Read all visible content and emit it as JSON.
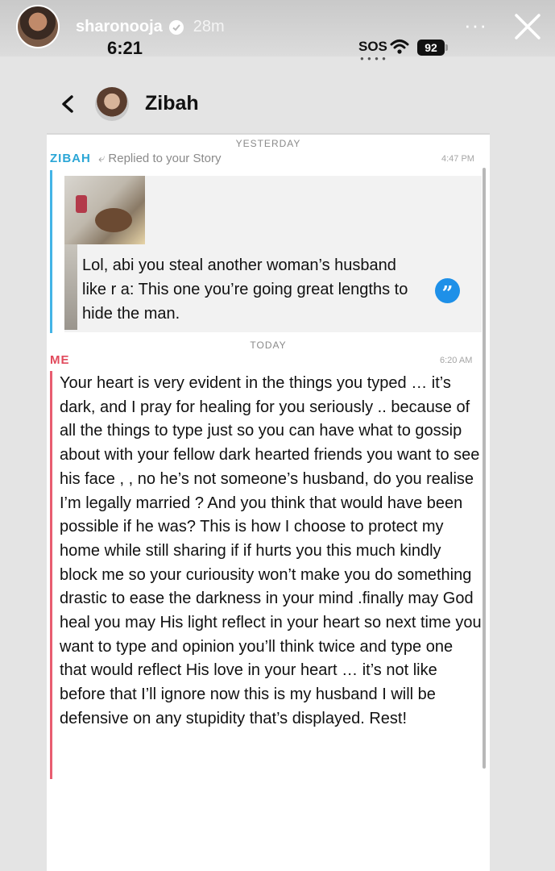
{
  "story": {
    "username": "sharonooja",
    "posted_ago": "28m",
    "more_label": "···",
    "close_icon": "close-icon"
  },
  "status_bar": {
    "time": "6:21",
    "sos": "SOS",
    "battery": "92"
  },
  "chat_header": {
    "back_icon": "chevron-left-icon",
    "contact_name": "Zibah"
  },
  "conversation": {
    "yesterday_label": "YESTERDAY",
    "today_label": "TODAY",
    "incoming": {
      "sender": "ZIBAH",
      "reply_label": "Replied to your Story",
      "time": "4:47 PM",
      "text": "Lol, abi you steal another woman’s husband like r       a: This one you’re going great lengths to hide the man."
    },
    "outgoing": {
      "sender": "ME",
      "time": "6:20 AM",
      "text": "Your heart is very evident in the things you typed … it’s dark, and I pray for healing for you seriously .. because of all the things to type just so you can have what to gossip about with your fellow dark hearted friends you want to see his face , , no he’s not someone’s husband, do you realise I’m legally married ? And you think that would have been possible if he was? This is how I choose to protect my home while still sharing if if hurts you this much kindly block me so your curiousity won’t make you do something drastic to ease the darkness in your mind .finally may God heal you may His light reflect in your heart so next time you want to type and opinion you’ll think twice and type one that would reflect His love in your heart … it’s not like before that I’ll ignore now this is my husband I will be defensive on any stupidity that’s displayed. Rest!"
    }
  },
  "colors": {
    "zibah": "#2aa6d6",
    "me": "#e14a5c",
    "quote_button": "#1e90e8"
  }
}
